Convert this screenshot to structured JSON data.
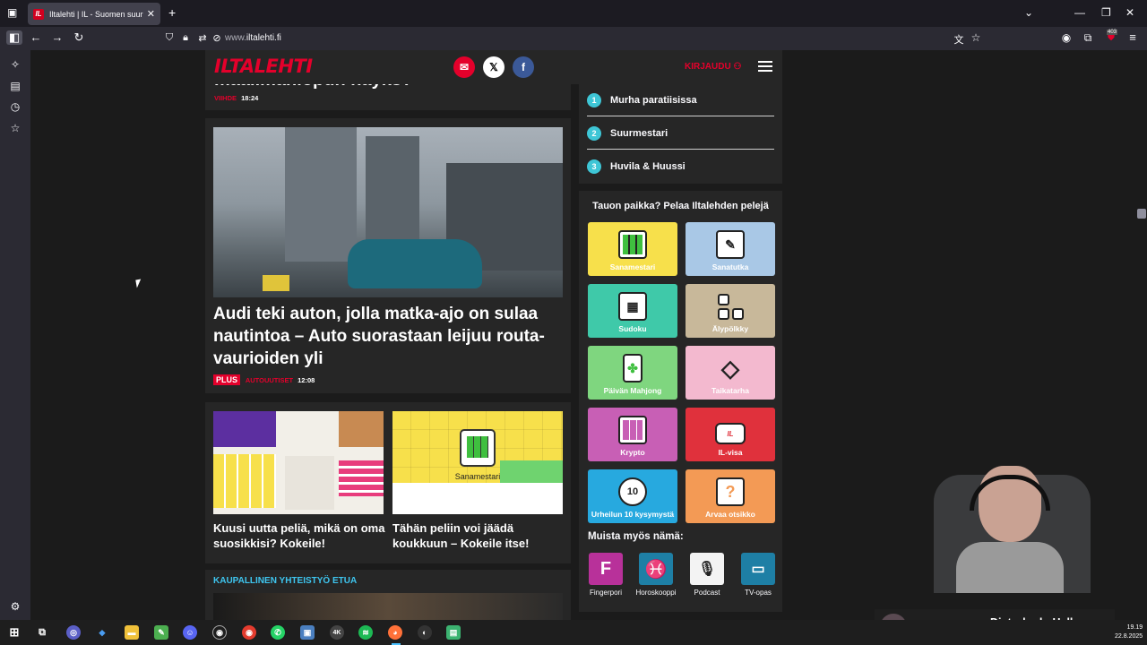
{
  "browser": {
    "tab_title": "Iltalehti | IL - Suomen suurin uu",
    "url_prefix": "www.",
    "url_domain": "iltalehti.fi",
    "badge_count": "403"
  },
  "site": {
    "logo": "ILTALEHTI",
    "login": "KIRJAUDU"
  },
  "articles": {
    "top_partial": "maailmanlopun näyks?",
    "top_category": "VIIHDE",
    "top_time": "18:24",
    "main_headline": "Audi teki auton, jolla matka-ajo on sulaa nautintoa – Auto suorastaan leijuu routa-vaurioiden yli",
    "main_plus": "PLUS",
    "main_category": "AUTOUUTISET",
    "main_time": "12:08",
    "small1_headline": "Kuusi uutta peliä, mikä on oma suosikkisi? Kokeile!",
    "small2_headline": "Tähän peliin voi jäädä koukkuun – Kokeile itse!",
    "small2_img_label": "Sanamestari",
    "commercial_label": "KAUPALLINEN YHTEISTYÖ ETUA"
  },
  "most_read": [
    {
      "num": "1",
      "label": "Murha paratiisissa"
    },
    {
      "num": "2",
      "label": "Suurmestari"
    },
    {
      "num": "3",
      "label": "Huvila & Huussi"
    }
  ],
  "games": {
    "title": "Tauon paikka? Pelaa Iltalehden pelejä",
    "items": [
      {
        "label": "Sanamestari",
        "color": "#f7e04b"
      },
      {
        "label": "Sanatutka",
        "color": "#a9c8e6"
      },
      {
        "label": "Sudoku",
        "color": "#3fc9a9"
      },
      {
        "label": "Älypölkky",
        "color": "#c8b89a"
      },
      {
        "label": "Päivän Mahjong",
        "color": "#7fd67f"
      },
      {
        "label": "Taikatarha",
        "color": "#f3b9cf"
      },
      {
        "label": "Krypto",
        "color": "#c85fb5"
      },
      {
        "label": "IL-visa",
        "color": "#e0313c"
      },
      {
        "label": "Urheilun 10 kysymystä",
        "color": "#27a9df"
      },
      {
        "label": "Arvaa otsikko",
        "color": "#f39a55"
      }
    ]
  },
  "muista": {
    "title": "Muista myös nämä:",
    "items": [
      {
        "label": "Fingerpori"
      },
      {
        "label": "Horoskooppi"
      },
      {
        "label": "Podcast"
      },
      {
        "label": "TV-opas"
      }
    ]
  },
  "media": {
    "artist": "Disturbed",
    "separator": "-",
    "track": "Hell"
  },
  "clock": {
    "time": "19.19",
    "date": "22.8.2025"
  }
}
